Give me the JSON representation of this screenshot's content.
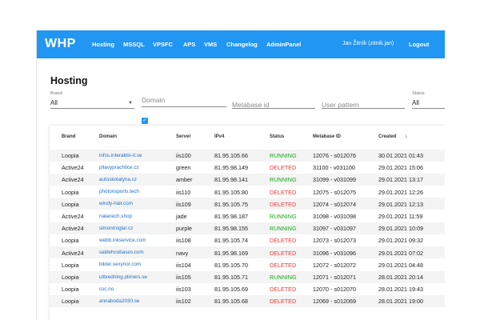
{
  "app": {
    "logo": "WHP",
    "nav": [
      "Hosting",
      "MSSQL",
      "VPSFC",
      "APS",
      "VMS",
      "Changelog",
      "AdminPanel"
    ],
    "user": "Jan Žitník (zitnik.jan)",
    "logout": "Logout"
  },
  "page": {
    "title": "Hosting"
  },
  "filters": {
    "brand_label": "Brand",
    "brand_value": "All",
    "domain_placeholder": "Domain",
    "metabase_placeholder": "Metabase id",
    "user_placeholder": "User pattern",
    "status_label": "Status",
    "status_value": "All",
    "checkbox_checked": true
  },
  "table": {
    "columns": [
      "Brand",
      "Domain",
      "Server",
      "IPv4",
      "Status",
      "Metabase ID",
      "Created"
    ],
    "sort_indicator": "↓",
    "rows": [
      {
        "brand": "Loopia",
        "domain": "infss.interaktiv-it.se",
        "server": "iis100",
        "ipv4": "81.95.105.66",
        "status": "RUNNING",
        "metabase": "12076 - s012076",
        "created": "30.01.2021 01:43"
      },
      {
        "brand": "Active24",
        "domain": "pilavyprachtice.cz",
        "server": "green",
        "ipv4": "81.95.98.149",
        "status": "DELETED",
        "metabase": "31100 - v031100",
        "created": "29.01.2021 15:06"
      },
      {
        "brand": "Active24",
        "domain": "autoskolatyna.cz",
        "server": "amber",
        "ipv4": "81.95.98.141",
        "status": "RUNNING",
        "metabase": "31099 - v031099",
        "created": "29.01.2021 13:17"
      },
      {
        "brand": "Loopia",
        "domain": "photonsports.tech",
        "server": "iis110",
        "ipv4": "81.95.105.80",
        "status": "DELETED",
        "metabase": "12075 - s012075",
        "created": "29.01.2021 12:26"
      },
      {
        "brand": "Loopia",
        "domain": "windy-hair.com",
        "server": "iis109",
        "ipv4": "81.95.105.75",
        "status": "DELETED",
        "metabase": "12074 - s012074",
        "created": "29.01.2021 12:13"
      },
      {
        "brand": "Active24",
        "domain": "nalanech.shop",
        "server": "jade",
        "ipv4": "81.95.98.187",
        "status": "RUNNING",
        "metabase": "31098 - v031098",
        "created": "29.01.2021 11:59"
      },
      {
        "brand": "Active24",
        "domain": "simontroglar.cz",
        "server": "purple",
        "ipv4": "81.95.98.155",
        "status": "RUNNING",
        "metabase": "31097 - v031097",
        "created": "29.01.2021 10:09"
      },
      {
        "brand": "Loopia",
        "domain": "webb.inkservice.com",
        "server": "iis108",
        "ipv4": "81.95.105.74",
        "status": "DELETED",
        "metabase": "12073 - s012073",
        "created": "29.01.2021 09:32"
      },
      {
        "brand": "Active24",
        "domain": "saldehcobases.com",
        "server": "navy",
        "ipv4": "81.95.98.169",
        "status": "DELETED",
        "metabase": "31096 - v031096",
        "created": "29.01.2021 07:02"
      },
      {
        "brand": "Loopia",
        "domain": "bilder.sexynor.com",
        "server": "iis104",
        "ipv4": "81.95.105.70",
        "status": "DELETED",
        "metabase": "12072 - s012072",
        "created": "29.01.2021 04:48"
      },
      {
        "brand": "Loopia",
        "domain": "utbredning.pliiners.se",
        "server": "iis105",
        "ipv4": "81.95.105.71",
        "status": "RUNNING",
        "metabase": "12071 - s012071",
        "created": "28.01.2021 20:14"
      },
      {
        "brand": "Loopia",
        "domain": "csc.no",
        "server": "iis103",
        "ipv4": "81.95.105.69",
        "status": "DELETED",
        "metabase": "12070 - s012070",
        "created": "28.01.2021 19:43"
      },
      {
        "brand": "Loopia",
        "domain": "annaboda2030.se",
        "server": "iis102",
        "ipv4": "81.95.105.68",
        "status": "DELETED",
        "metabase": "12069 - s012069",
        "created": "28.01.2021 19:00"
      }
    ]
  },
  "colors": {
    "navbar": "#2196f3",
    "running": "#1aa51a",
    "deleted": "#e53935",
    "link": "#1e6fc4"
  }
}
